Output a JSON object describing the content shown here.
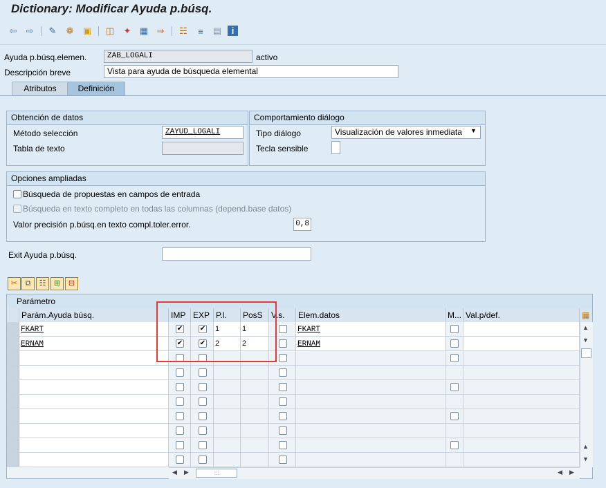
{
  "window": {
    "title": "Dictionary: Modificar Ayuda p.búsq."
  },
  "toolbar": {
    "icons": [
      "back-icon",
      "forward-icon",
      "display-change-icon",
      "other-object-icon",
      "activate-icon",
      "where-used-icon",
      "magic-wand-icon",
      "hierarchy-icon",
      "navigate-icon",
      "object-list-icon",
      "technical-settings-icon",
      "layout-icon",
      "info-icon"
    ]
  },
  "header": {
    "elem_label": "Ayuda p.búsq.elemen.",
    "elem_value": "ZAB_LOGALI",
    "status": "activo",
    "desc_label": "Descripción breve",
    "desc_value": "Vista para ayuda de búsqueda elemental"
  },
  "tabs": [
    {
      "label": "Atributos"
    },
    {
      "label": "Definición"
    }
  ],
  "data_group": {
    "title": "Obtención de datos",
    "method_label": "Método selección",
    "method_value": "ZAYUD_LOGALI",
    "text_table_label": "Tabla de texto",
    "text_table_value": ""
  },
  "dialog_group": {
    "title": "Comportamiento diálogo",
    "type_label": "Tipo diálogo",
    "type_value": "Visualización de valores inmediata",
    "hotkey_label": "Tecla sensible",
    "hotkey_value": ""
  },
  "extended_group": {
    "title": "Opciones ampliadas",
    "option1": "Búsqueda de propuestas en campos de entrada",
    "option2": "Búsqueda en texto completo en todas las columnas (depend.base datos)",
    "precision_label": "Valor precisión p.búsq.en texto compl.toler.error.",
    "precision_value": "0,8"
  },
  "exit": {
    "label": "Exit Ayuda p.búsq.",
    "value": ""
  },
  "table_tools": [
    "cut-icon",
    "copy-icon",
    "paste-icon",
    "insert-row-icon",
    "delete-row-icon"
  ],
  "table": {
    "title": "Parámetro",
    "columns": [
      "Parám.Ayuda búsq.",
      "IMP",
      "EXP",
      "P.l.",
      "PosS",
      "V.s.",
      "Elem.datos",
      "M...",
      "Val.p/def."
    ],
    "rows": [
      {
        "param": "FKART",
        "imp": true,
        "exp": true,
        "pl": "1",
        "poss": "1",
        "vs": false,
        "elem": "FKART",
        "m": false,
        "def": ""
      },
      {
        "param": "ERNAM",
        "imp": true,
        "exp": true,
        "pl": "2",
        "poss": "2",
        "vs": false,
        "elem": "ERNAM",
        "m": false,
        "def": ""
      }
    ],
    "empty_rows": 8
  },
  "colors": {
    "background": "#dfebf5",
    "highlight": "#e53935"
  }
}
